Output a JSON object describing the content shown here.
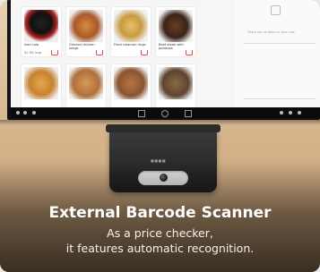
{
  "feature": {
    "title": "External Barcode Scanner",
    "description_lines": [
      "As a price checker,",
      "it features automatic recognition."
    ]
  },
  "screen": {
    "tiles": [
      {
        "name": "Iced cola",
        "price": "$1.99 /cup",
        "img": "#c33333"
      },
      {
        "name": "Orleans chicken wings",
        "price": "",
        "img": "#c9773a"
      },
      {
        "name": "Fried calamari rings",
        "price": "",
        "img": "#d9b35f"
      },
      {
        "name": "Beef steak with potatoes",
        "price": "",
        "img": "#5b3a2a"
      },
      {
        "name": "",
        "price": "",
        "img": "#e0a34d"
      },
      {
        "name": "",
        "price": "",
        "img": "#d3944e"
      },
      {
        "name": "",
        "price": "",
        "img": "#b07040"
      },
      {
        "name": "",
        "price": "",
        "img": "#7a5a3a"
      }
    ],
    "right_panel_message": "There are no items in your cart"
  },
  "icons": {
    "cart": "cart-icon",
    "bell": "bell-icon",
    "lens": "camera-lens-icon"
  },
  "colors": {
    "accent": "#e44444",
    "scanner_body": "#2a2a2a",
    "text": "#ffffff"
  }
}
